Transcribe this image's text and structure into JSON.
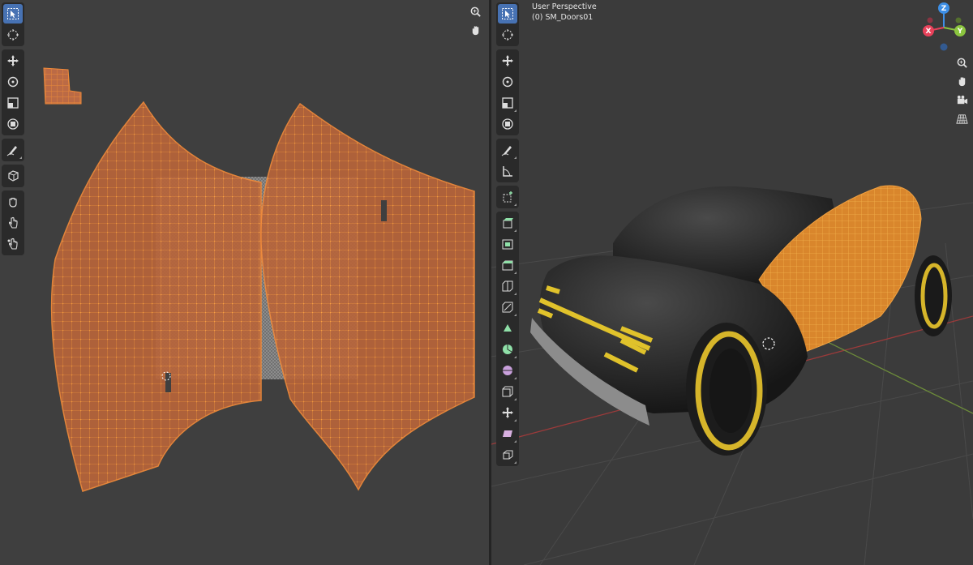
{
  "uv_editor": {
    "tools": [
      {
        "name": "tweak-tool",
        "active": true
      },
      {
        "name": "cursor-tool"
      },
      {
        "name": "move-tool"
      },
      {
        "name": "rotate-tool"
      },
      {
        "name": "scale-tool"
      },
      {
        "name": "transform-tool"
      },
      {
        "name": "annotate-tool"
      },
      {
        "name": "rip-region-tool"
      },
      {
        "name": "grab-tool"
      },
      {
        "name": "relax-tool"
      },
      {
        "name": "pinch-tool"
      }
    ],
    "nav": [
      "zoom-icon",
      "hand-icon"
    ]
  },
  "viewport": {
    "view_name": "User Perspective",
    "object_info": "(0) SM_Doors01",
    "gizmo_axes": {
      "x": "X",
      "y": "Y",
      "z": "Z"
    },
    "colors": {
      "axis_x": "#e8415a",
      "axis_y": "#8bc53f",
      "axis_z": "#3d8fe6",
      "uv_orange": "#e27a30",
      "accent_yellow": "#e0c22b",
      "active_blue": "#4772b3"
    },
    "nav": [
      "zoom-icon",
      "hand-icon",
      "camera-icon",
      "grid-icon"
    ]
  }
}
